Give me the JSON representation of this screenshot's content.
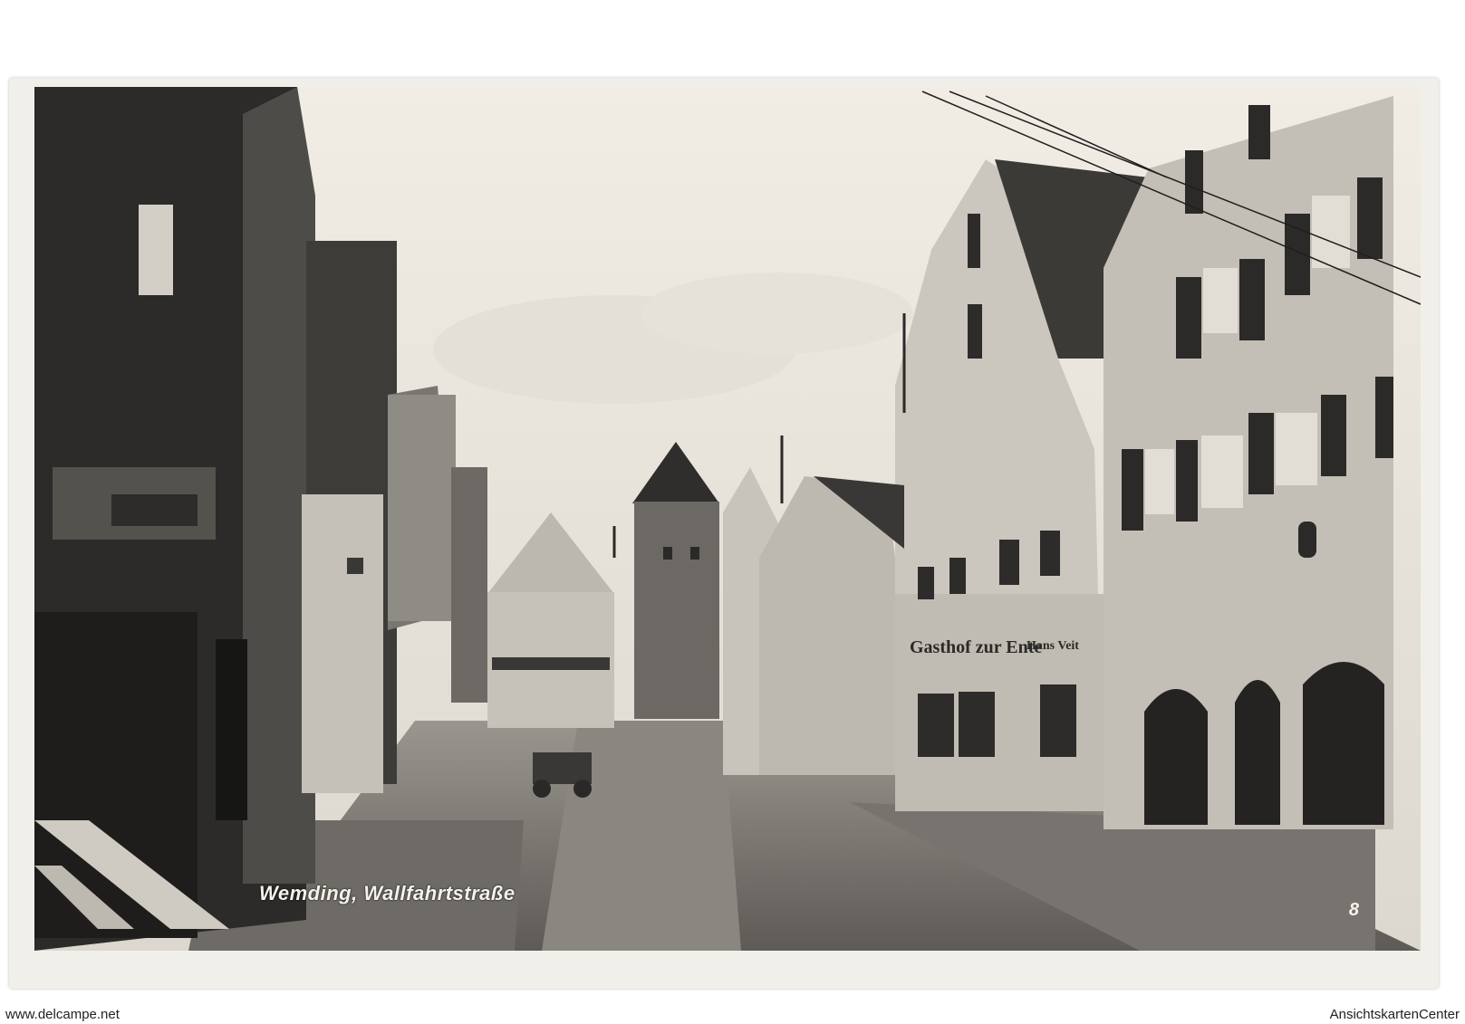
{
  "postcard": {
    "caption": "Wemding, Wallfahrtstraße",
    "number": "8",
    "sign_gasthof": "Gasthof zur Ente",
    "sign_owner": "Hans Veit"
  },
  "footer": {
    "left": "www.delcampe.net",
    "right": "AnsichtskartenCenter"
  },
  "colors": {
    "sky": "#ece8df",
    "shadow": "#2a2a2a",
    "facade_light": "#c9c5bc",
    "street": "#7b7873"
  }
}
